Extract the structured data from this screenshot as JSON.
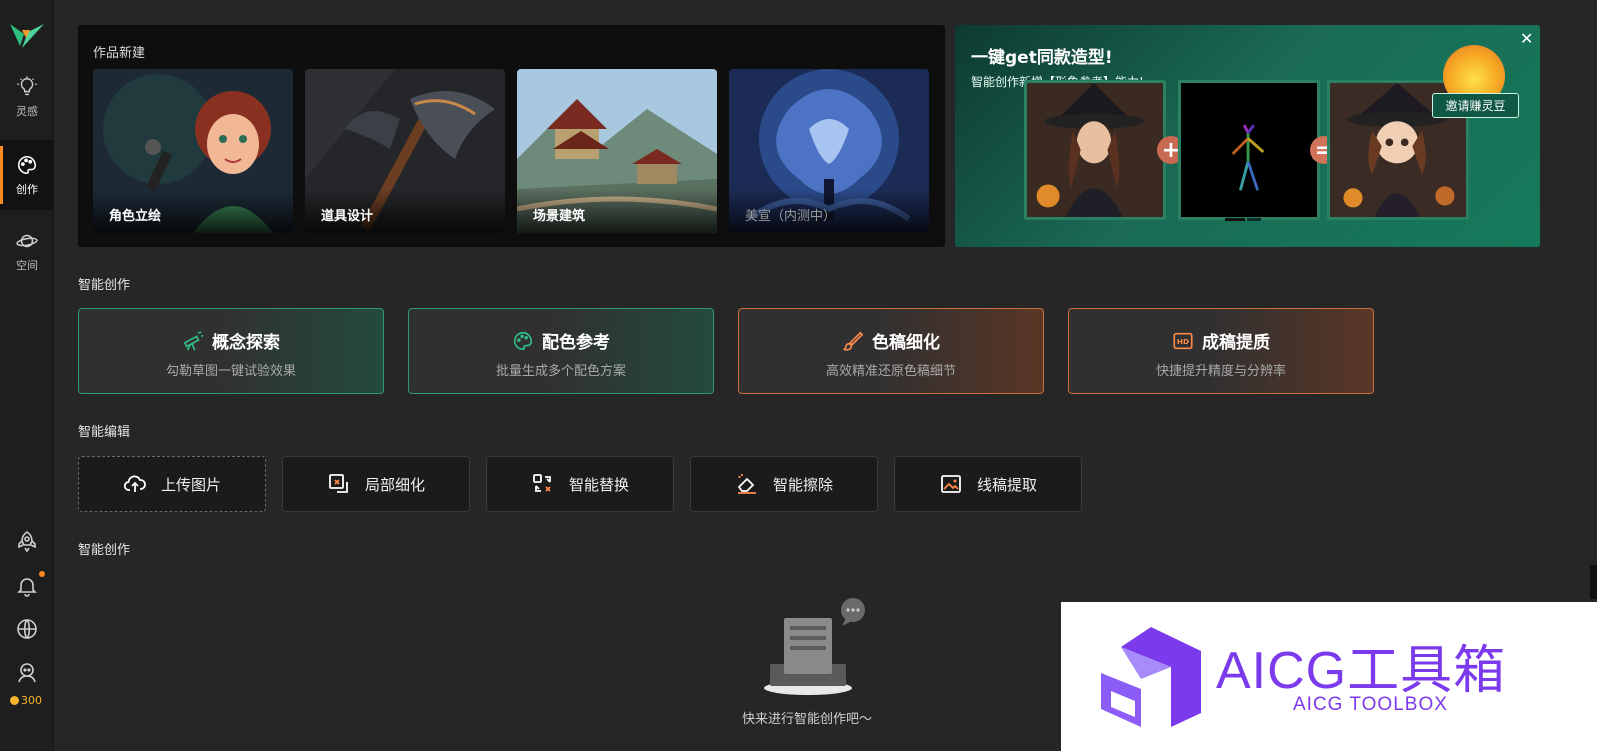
{
  "sidebar": {
    "items": [
      {
        "label": "灵感",
        "icon": "lightbulb-icon"
      },
      {
        "label": "创作",
        "icon": "palette-icon",
        "active": true
      },
      {
        "label": "空间",
        "icon": "planet-icon"
      }
    ],
    "coins": "300"
  },
  "new_works": {
    "title": "作品新建",
    "cards": [
      {
        "label": "角色立绘"
      },
      {
        "label": "道具设计"
      },
      {
        "label": "场景建筑"
      },
      {
        "label": "美宣（内测中）"
      }
    ]
  },
  "promo": {
    "title": "一键get同款造型!",
    "subtitle": "智能创作新增【形象参考】能力!",
    "invite_label": "邀请赚灵豆",
    "close_label": "✕"
  },
  "smart_creation": {
    "heading": "智能创作",
    "cards": [
      {
        "title": "概念探索",
        "desc": "勾勒草图一键试验效果",
        "icon": "telescope-icon",
        "accent": "#2f9a72"
      },
      {
        "title": "配色参考",
        "desc": "批量生成多个配色方案",
        "icon": "palette-icon",
        "accent": "#2f9a72"
      },
      {
        "title": "色稿细化",
        "desc": "高效精准还原色稿细节",
        "icon": "brush-icon",
        "accent": "#c96e3c"
      },
      {
        "title": "成稿提质",
        "desc": "快捷提升精度与分辨率",
        "icon": "hd-icon",
        "accent": "#c96e3c"
      }
    ]
  },
  "smart_edit": {
    "heading": "智能编辑",
    "buttons": [
      {
        "label": "上传图片",
        "icon": "upload-cloud-icon"
      },
      {
        "label": "局部细化",
        "icon": "crop-refine-icon"
      },
      {
        "label": "智能替换",
        "icon": "swap-icon"
      },
      {
        "label": "智能擦除",
        "icon": "eraser-icon"
      },
      {
        "label": "线稿提取",
        "icon": "image-icon"
      }
    ]
  },
  "history": {
    "heading": "智能创作",
    "empty_text": "快来进行智能创作吧～"
  },
  "watermark": {
    "title": "AICG工具箱",
    "subtitle": "AICG TOOLBOX"
  },
  "colors": {
    "accent_orange": "#ff8a1f",
    "green": "#2f9a72",
    "orange": "#c96e3c",
    "watermark_purple": "#7c3aed"
  }
}
